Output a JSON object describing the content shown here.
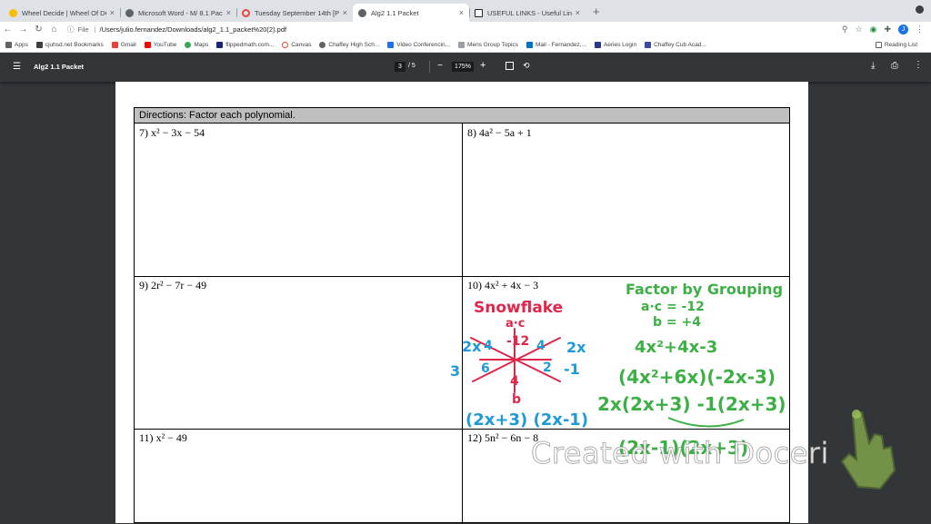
{
  "tabs": [
    {
      "label": "Wheel Decide | Wheel Of DOOM",
      "color": "#fbbc04"
    },
    {
      "label": "Microsoft Word - M/ 8.1 Packet",
      "color": "#5f6368"
    },
    {
      "label": "Tuesday September 14th [Prac",
      "color": "#e8453c"
    },
    {
      "label": "Alg2 1.1 Packet",
      "color": "#5f6368"
    },
    {
      "label": "USEFUL LINKS - Useful Links",
      "color": "#202124"
    }
  ],
  "address": {
    "scheme": "File",
    "url": "/Users/julio.fernandez/Downloads/alg2_1.1_packet%20(2).pdf",
    "profile": "J"
  },
  "bookmarks": [
    {
      "label": "Apps",
      "color": "#5f6368"
    },
    {
      "label": "cjuhsd.net Bookmarks",
      "color": "#3c4043"
    },
    {
      "label": "Gmail",
      "color": "#ea4335"
    },
    {
      "label": "YouTube",
      "color": "#ff0000"
    },
    {
      "label": "Maps",
      "color": "#34a853"
    },
    {
      "label": "flippedmath.com...",
      "color": "#1a237e"
    },
    {
      "label": "Canvas",
      "color": "#e94b35"
    },
    {
      "label": "Chaffey High Sch...",
      "color": "#5f6368"
    },
    {
      "label": "Video Conferencin...",
      "color": "#1a73e8"
    },
    {
      "label": "Mens Group Topics",
      "color": "#9aa0a6"
    },
    {
      "label": "Mail - Fernandez,...",
      "color": "#0072c6"
    },
    {
      "label": "Aeries Login",
      "color": "#283593"
    },
    {
      "label": "Chaffey Cub Acad...",
      "color": "#3949ab"
    }
  ],
  "reading_list": "Reading List",
  "pdf": {
    "title": "Alg2 1.1 Packet",
    "page": "3",
    "total": "/  5",
    "zoom": "175%"
  },
  "worksheet": {
    "directions": "Directions:  Factor each polynomial.",
    "problems": [
      {
        "num": "7)",
        "expr": "x² − 3x − 54"
      },
      {
        "num": "8)",
        "expr": "4a² − 5a + 1"
      },
      {
        "num": "9)",
        "expr": "2r² − 7r − 49"
      },
      {
        "num": "10)",
        "expr": "4x² + 4x − 3"
      },
      {
        "num": "11)",
        "expr": "x² − 49"
      },
      {
        "num": "12)",
        "expr": "5n² − 6n − 8"
      }
    ]
  },
  "annotations": {
    "snowflake": "Snowflake",
    "ac": "a·c",
    "b": "b",
    "ac_value": "-12",
    "b_value": "+4",
    "left_top": "2x",
    "left_mid": "4",
    "right_top": "4",
    "right_top2": "2x",
    "left_num": "3",
    "left_num2": "6",
    "right_num": "2",
    "right_num2": "-1",
    "bottom_num": "4",
    "answer": "(2x+3) (2x-1)",
    "grouping_title": "Factor by Grouping",
    "grouping_ac": "a·c = -12",
    "grouping_b": "b = +4",
    "step1": "4x²+4x-3",
    "step2": "(4x²+6x)(-2x-3)",
    "step3": "2x(2x+3) -1(2x+3)",
    "step4": "(2x-1)(2x+3)"
  },
  "watermark": "Created with Doceri",
  "colors": {
    "red": "#e0264a",
    "blue": "#1e9ad6",
    "green": "#3cb045"
  }
}
